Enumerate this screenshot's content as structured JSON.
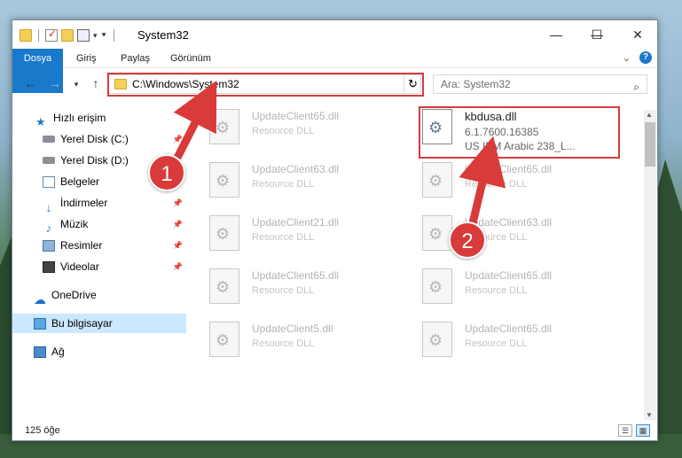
{
  "window": {
    "title": "System32"
  },
  "ribbon": {
    "tabs": [
      "Dosya",
      "Giriş",
      "Paylaş",
      "Görünüm"
    ]
  },
  "navigation": {
    "address": "C:\\Windows\\System32",
    "search_placeholder": "Ara: System32"
  },
  "sidebar": {
    "items": [
      {
        "label": "Hızlı erişim",
        "icon": "star-icon"
      },
      {
        "label": "Yerel Disk (C:)",
        "icon": "drive-icon",
        "pinned": true
      },
      {
        "label": "Yerel Disk (D:)",
        "icon": "drive-icon"
      },
      {
        "label": "Belgeler",
        "icon": "documents-icon"
      },
      {
        "label": "İndirmeler",
        "icon": "download-icon",
        "pinned": true
      },
      {
        "label": "Müzik",
        "icon": "music-icon",
        "pinned": true
      },
      {
        "label": "Resimler",
        "icon": "pictures-icon",
        "pinned": true
      },
      {
        "label": "Videolar",
        "icon": "videos-icon",
        "pinned": true
      },
      {
        "label": "OneDrive",
        "icon": "onedrive-icon"
      },
      {
        "label": "Bu bilgisayar",
        "icon": "computer-icon",
        "selected": true
      },
      {
        "label": "Ağ",
        "icon": "network-icon"
      }
    ]
  },
  "files": [
    {
      "name": "UpdateClient65.dll",
      "desc": "Resource DLL"
    },
    {
      "name": "kbdusa.dll",
      "desc": "6.1.7600.16385",
      "desc2": "US IBM Arabic 238_L...",
      "active": true
    },
    {
      "name": "UpdateClient63.dll",
      "desc": "Resource DLL"
    },
    {
      "name": "UpdateClient65.dll",
      "desc": "Resource DLL"
    },
    {
      "name": "UpdateClient21.dll",
      "desc": "Resource DLL"
    },
    {
      "name": "UpdateClient63.dll",
      "desc": "Resource DLL"
    },
    {
      "name": "UpdateClient65.dll",
      "desc": "Resource DLL"
    },
    {
      "name": "UpdateClient65.dll",
      "desc": "Resource DLL"
    },
    {
      "name": "UpdateClient5.dll",
      "desc": "Resource DLL"
    },
    {
      "name": "UpdateClient65.dll",
      "desc": "Resource DLL"
    }
  ],
  "status": {
    "count": "125 öğe"
  },
  "callouts": [
    "1",
    "2"
  ],
  "colors": {
    "accent": "#1979ca",
    "highlight": "#d63c3c",
    "selected": "#cce8ff"
  }
}
